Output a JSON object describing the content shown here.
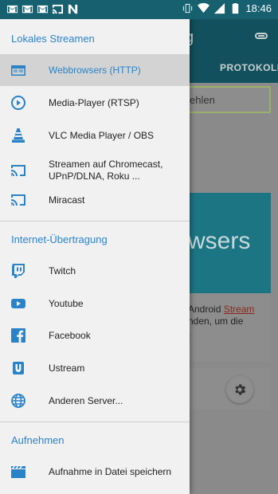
{
  "status_bar": {
    "time": "18:46",
    "left_icons": [
      "gmail-icon",
      "gmail-icon",
      "gmail-icon",
      "cast-notification-icon",
      "n-icon"
    ],
    "right_icons": [
      "vibrate-icon",
      "wifi-icon",
      "signal-icon",
      "battery-icon"
    ]
  },
  "background": {
    "title_fragment": "g",
    "tab_label": "PROTOKOLLE",
    "input_fragment": "ehlen",
    "card_fragment": "wsers",
    "text_line1": "Android ",
    "text_link": "Stream",
    "text_line2": "nden, um die",
    "text_line3": "."
  },
  "drawer": {
    "sections": [
      {
        "header": "Lokales Streamen",
        "items": [
          {
            "label": "Webbrowsers (HTTP)",
            "icon": "browser-icon",
            "selected": true
          },
          {
            "label": "Media-Player (RTSP)",
            "icon": "play-circle-icon",
            "selected": false
          },
          {
            "label": "VLC Media Player / OBS",
            "icon": "vlc-cone-icon",
            "selected": false
          },
          {
            "label": "Streamen auf Chromecast,",
            "label2": "UPnP/DLNA, Roku ...",
            "icon": "cast-icon",
            "selected": false
          },
          {
            "label": "Miracast",
            "icon": "cast-icon",
            "selected": false
          }
        ]
      },
      {
        "header": "Internet-Übertragung",
        "items": [
          {
            "label": "Twitch",
            "icon": "twitch-icon",
            "selected": false
          },
          {
            "label": "Youtube",
            "icon": "youtube-icon",
            "selected": false
          },
          {
            "label": "Facebook",
            "icon": "facebook-icon",
            "selected": false
          },
          {
            "label": "Ustream",
            "icon": "ustream-icon",
            "selected": false
          },
          {
            "label": "Anderen Server...",
            "icon": "globe-icon",
            "selected": false
          }
        ]
      },
      {
        "header": "Aufnehmen",
        "items": [
          {
            "label": "Aufnahme in Datei speichern",
            "icon": "clapperboard-icon",
            "selected": false
          }
        ]
      }
    ]
  },
  "colors": {
    "accent": "#2a83c6",
    "status_bar": "#16606f",
    "drawer_bg": "#f1f1f1",
    "selected_bg": "#d3d3d3"
  }
}
